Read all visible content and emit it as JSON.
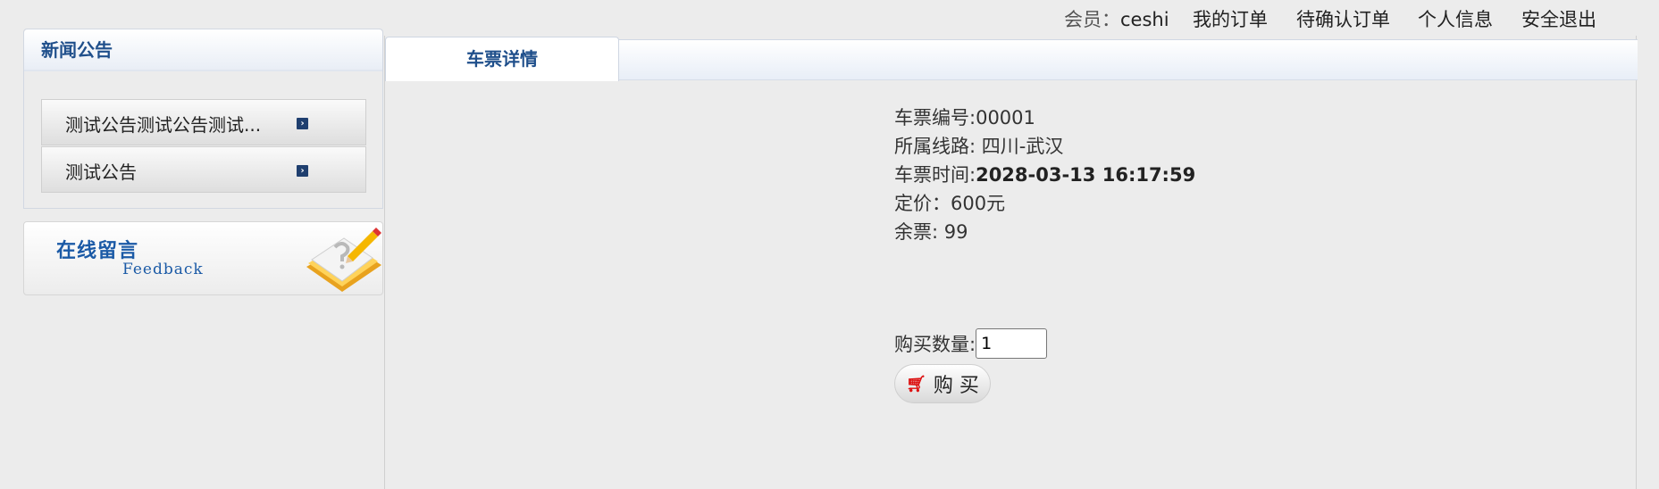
{
  "user_bar": {
    "member_label": "会员：",
    "member_name": "ceshi",
    "links": [
      "我的订单",
      "待确认订单",
      "个人信息",
      "安全退出"
    ]
  },
  "sidebar": {
    "news": {
      "title": "新闻公告",
      "items": [
        {
          "label": "测试公告测试公告测试..."
        },
        {
          "label": "测试公告"
        }
      ]
    },
    "feedback": {
      "title_cn": "在线留言",
      "title_en": "Feedback"
    }
  },
  "main": {
    "tab_label": "车票详情",
    "ticket": {
      "number_label": "车票编号:",
      "number_value": "00001",
      "route_label": "所属线路: ",
      "route_value": "四川-武汉",
      "time_label": "车票时间:",
      "time_value": "2028-03-13 16:17:59",
      "price_label": "定价：",
      "price_value": "600元",
      "remaining_label": "余票: ",
      "remaining_value": "99"
    },
    "purchase": {
      "qty_label": "购买数量:",
      "qty_value": "1",
      "buy_label": "购 买"
    }
  },
  "icons": {
    "news_arrow": "chevron-right-icon",
    "cart": "cart-icon",
    "feedback": "notebook-pencil-icon"
  },
  "colors": {
    "accent_blue": "#1f4f8b",
    "feedback_blue": "#1b5aa6",
    "background": "#ececec"
  }
}
